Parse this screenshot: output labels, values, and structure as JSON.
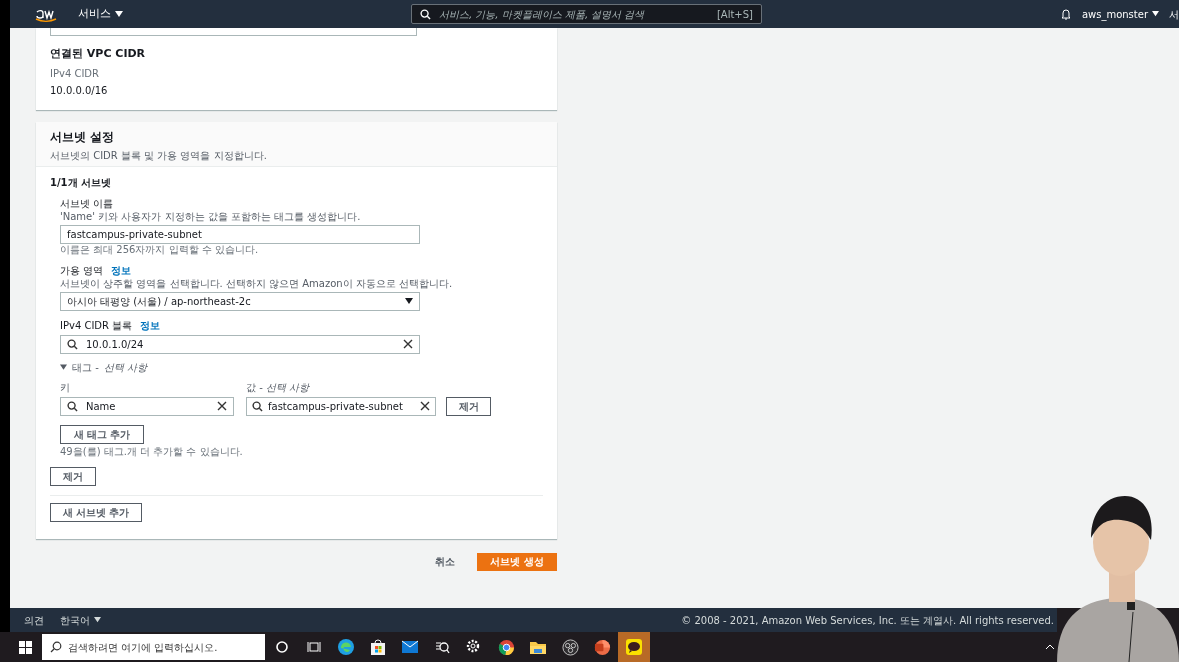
{
  "nav": {
    "services": "서비스",
    "search_placeholder": "서비스, 기능, 마켓플레이스 제품, 설명서 검색",
    "shortcut": "[Alt+S]",
    "user": "aws_monster",
    "region": "서"
  },
  "vpc_card": {
    "title": "연결된 VPC CIDR",
    "label": "IPv4 CIDR",
    "value": "10.0.0.0/16"
  },
  "subnet_card": {
    "title": "서브넷 설정",
    "description": "서브넷의 CIDR 블록 및 가용 영역을 지정합니다.",
    "count": "1/1개 서브넷",
    "name_field": {
      "label": "서브넷 이름",
      "hint": "'Name' 키와 사용자가 지정하는 값을 포함하는 태그를 생성합니다.",
      "value": "fastcampus-private-subnet",
      "constraint": "이름은 최대 256자까지 입력할 수 있습니다."
    },
    "az_field": {
      "label": "가용 영역",
      "info": "정보",
      "hint": "서브넷이 상주할 영역을 선택합니다. 선택하지 않으면 Amazon이 자동으로 선택합니다.",
      "value": "아시아 태평양 (서울) / ap-northeast-2c"
    },
    "cidr_field": {
      "label": "IPv4 CIDR 블록",
      "info": "정보",
      "value": "10.0.1.0/24"
    },
    "tags": {
      "title": "태그 - ",
      "title_optional": "선택 사항",
      "expanded": true,
      "key_label": "키",
      "value_label": "값 - ",
      "value_label_optional": "선택 사항",
      "rows": [
        {
          "key": "Name",
          "value": "fastcampus-private-subnet",
          "remove": "제거"
        }
      ],
      "add": "새 태그 추가",
      "remaining": "49을(를) 태그.개 더 추가할 수 있습니다."
    },
    "remove": "제거",
    "add_subnet": "새 서브넷 추가"
  },
  "actions": {
    "cancel": "취소",
    "create": "서브넷 생성"
  },
  "footer": {
    "feedback": "의견",
    "language": "한국어",
    "copyright": "© 2008 - 2021, Amazon Web Services, Inc. 또는 계열사. All rights reserved."
  },
  "taskbar": {
    "search_placeholder": "검색하려면 여기에 입력하십시오.",
    "apps": [
      {
        "kind": "cortana",
        "selected": false
      },
      {
        "kind": "taskview",
        "selected": false
      },
      {
        "kind": "edge",
        "selected": false
      },
      {
        "kind": "store",
        "selected": false
      },
      {
        "kind": "mail",
        "selected": false
      },
      {
        "kind": "search",
        "selected": false
      },
      {
        "kind": "settings",
        "selected": false
      },
      {
        "kind": "chrome",
        "selected": false
      },
      {
        "kind": "folder",
        "selected": false
      },
      {
        "kind": "obs",
        "selected": false
      },
      {
        "kind": "powerpoint",
        "selected": false
      },
      {
        "kind": "chat",
        "selected": true
      }
    ]
  }
}
